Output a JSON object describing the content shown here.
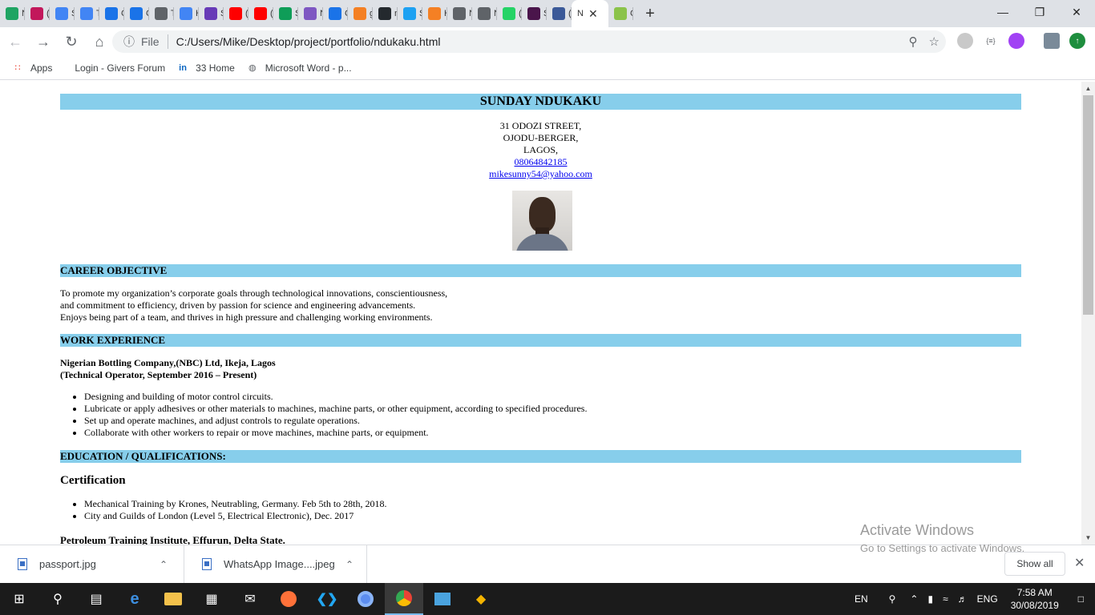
{
  "browser": {
    "tabs": [
      {
        "label": "N",
        "icon": "drive-icon",
        "color": "#1fa463"
      },
      {
        "label": "(",
        "icon": "mail-icon",
        "color": "#c2185b"
      },
      {
        "label": "S",
        "icon": "docs-icon",
        "color": "#4285f4"
      },
      {
        "label": "T",
        "icon": "docs-icon",
        "color": "#4285f4"
      },
      {
        "label": "C",
        "icon": "cloud-icon",
        "color": "#1a73e8"
      },
      {
        "label": "C",
        "icon": "cloud-icon",
        "color": "#1a73e8"
      },
      {
        "label": "T",
        "icon": "globe-icon",
        "color": "#5f6368"
      },
      {
        "label": "H",
        "icon": "docs-icon",
        "color": "#4285f4"
      },
      {
        "label": "S",
        "icon": "forms-icon",
        "color": "#673ab7"
      },
      {
        "label": "(",
        "icon": "youtube-icon",
        "color": "#ff0000"
      },
      {
        "label": "(",
        "icon": "youtube-icon",
        "color": "#ff0000"
      },
      {
        "label": "S",
        "icon": "sheets-icon",
        "color": "#0f9d58"
      },
      {
        "label": "N",
        "icon": "hexagon-icon",
        "color": "#7e57c2"
      },
      {
        "label": "C",
        "icon": "cloud-icon",
        "color": "#1a73e8"
      },
      {
        "label": "g",
        "icon": "stack-icon",
        "color": "#f48024"
      },
      {
        "label": "n",
        "icon": "github-icon",
        "color": "#24292e"
      },
      {
        "label": "S",
        "icon": "twitter-icon",
        "color": "#1da1f2"
      },
      {
        "label": "H",
        "icon": "stackoverflow-icon",
        "color": "#f48024"
      },
      {
        "label": "N",
        "icon": "globe-icon",
        "color": "#5f6368"
      },
      {
        "label": "N",
        "icon": "globe-icon",
        "color": "#5f6368"
      },
      {
        "label": "(",
        "icon": "whatsapp-icon",
        "color": "#25d366"
      },
      {
        "label": "S",
        "icon": "slack-icon",
        "color": "#4a154b"
      },
      {
        "label": "(",
        "icon": "facebook-icon",
        "color": "#3b5998"
      },
      {
        "label": "N",
        "icon": "document-icon",
        "color": "#ffffff",
        "active": true
      },
      {
        "label": "C",
        "icon": "w3c-icon",
        "color": "#8bc34a"
      }
    ],
    "new_tab": "+",
    "address": {
      "scheme_label": "File",
      "url": "C:/Users/Mike/Desktop/project/portfolio/ndukaku.html"
    },
    "bookmarks": [
      {
        "label": "Apps",
        "icon": "apps-grid-icon"
      },
      {
        "label": "Login - Givers Forum",
        "icon": "blank-page-icon"
      },
      {
        "label": "33 Home",
        "icon": "linkedin-icon"
      },
      {
        "label": "Microsoft Word - p...",
        "icon": "globe-icon"
      }
    ]
  },
  "cv": {
    "name": "SUNDAY NDUKAKU",
    "address_lines": [
      "31 ODOZI STREET,",
      "OJODU-BERGER,",
      "LAGOS,"
    ],
    "phone": "08064842185",
    "email": "mikesunny54@yahoo.com",
    "sections": {
      "career": "CAREER OBJECTIVE",
      "work": "WORK EXPERIENCE",
      "education": "EDUCATION / QUALIFICATIONS:"
    },
    "career_lines": [
      "To promote my organization’s corporate goals through technological innovations, conscientiousness,",
      "and commitment to efficiency, driven by passion for science and engineering advancements.",
      "Enjoys being part of a team, and thrives in high pressure and challenging working environments."
    ],
    "job": {
      "company": "Nigerian Bottling Company,(NBC) Ltd, Ikeja, Lagos",
      "role": "(Technical Operator, September 2016 – Present)",
      "duties": [
        "Designing and building of motor control circuits.",
        "Lubricate or apply adhesives or other materials to machines, machine parts, or other equipment, according to specified procedures.",
        "Set up and operate machines, and adjust controls to regulate operations.",
        "Collaborate with other workers to repair or move machines, machine parts, or equipment."
      ]
    },
    "certification_heading": "Certification",
    "certifications": [
      "Mechanical Training by Krones, Neutrabling, Germany. Feb 5th to 28th, 2018.",
      "City and Guilds of London (Level 5, Electrical Electronic), Dec. 2017"
    ],
    "next_heading": "Petroleum Training Institute, Effurun, Delta State."
  },
  "downloads": [
    {
      "name": "passport.jpg"
    },
    {
      "name": "WhatsApp Image....jpeg"
    }
  ],
  "show_all": "Show all",
  "activate": {
    "title": "Activate Windows",
    "subtitle": "Go to Settings to activate Windows."
  },
  "taskbar": {
    "lang": "EN",
    "input": "ENG",
    "time": "7:58 AM",
    "date": "30/08/2019"
  }
}
